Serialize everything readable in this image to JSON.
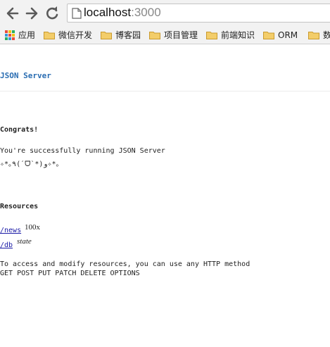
{
  "browser": {
    "url_host": "localhost",
    "url_port": ":3000",
    "bookmarks": {
      "apps_label": "应用",
      "items": [
        "微信开发",
        "博客园",
        "项目管理",
        "前端知识",
        "ORM",
        "数"
      ]
    }
  },
  "page": {
    "brand": "JSON Server",
    "congrats_heading": "Congrats!",
    "message": "You're successfully running JSON Server",
    "emoticon": "✧*｡٩(ˊᗜˋ*)و✧*｡",
    "resources_heading": "Resources",
    "resources": [
      {
        "path": "/news",
        "note": "100x"
      },
      {
        "path": "/db",
        "note": "state"
      }
    ],
    "access_text": "To access and modify resources, you can use any HTTP method",
    "methods_text": "GET POST PUT PATCH DELETE OPTIONS"
  },
  "colors": {
    "brand": "#2a6db2",
    "link": "#1a1aa6",
    "folder": "#e8b94a"
  }
}
